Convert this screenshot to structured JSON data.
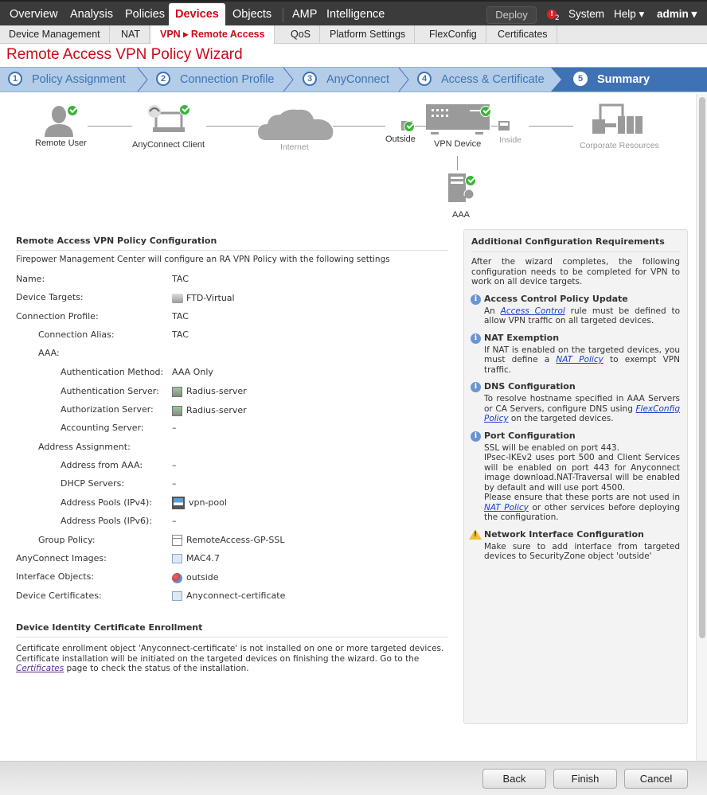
{
  "topnav": {
    "items": [
      "Overview",
      "Analysis",
      "Policies",
      "Devices",
      "Objects",
      "AMP",
      "Intelligence"
    ],
    "active": "Devices",
    "deploy": "Deploy",
    "alert_count": "2",
    "system": "System",
    "help": "Help ▾",
    "user": "admin ▾"
  },
  "subnav": {
    "items": [
      "Device Management",
      "NAT",
      "VPN ▸ Remote Access",
      "QoS",
      "Platform Settings",
      "FlexConfig",
      "Certificates"
    ],
    "active": "VPN ▸ Remote Access"
  },
  "page_title": "Remote Access VPN Policy Wizard",
  "steps": [
    {
      "num": "1",
      "label": "Policy Assignment"
    },
    {
      "num": "2",
      "label": "Connection Profile"
    },
    {
      "num": "3",
      "label": "AnyConnect"
    },
    {
      "num": "4",
      "label": "Access & Certificate"
    },
    {
      "num": "5",
      "label": "Summary",
      "active": true
    }
  ],
  "diagram": {
    "remote_user": "Remote User",
    "anyconnect_client": "AnyConnect Client",
    "internet": "Internet",
    "outside": "Outside",
    "vpn_device": "VPN Device",
    "inside": "Inside",
    "corporate_resources": "Corporate Resources",
    "aaa": "AAA"
  },
  "config": {
    "title": "Remote Access VPN Policy Configuration",
    "intro": "Firepower Management Center will configure an RA VPN Policy with the following settings",
    "rows": [
      {
        "label": "Name:",
        "value": "TAC"
      },
      {
        "label": "Device Targets:",
        "value": "FTD-Virtual",
        "icon": "device-icon"
      },
      {
        "label": "Connection Profile:",
        "value": "TAC"
      },
      {
        "label": "Connection Alias:",
        "value": "TAC"
      },
      {
        "label": "AAA:",
        "value": ""
      },
      {
        "label": "Authentication Method:",
        "value": "AAA Only"
      },
      {
        "label": "Authentication Server:",
        "value": "Radius-server",
        "icon": "radius-server-icon"
      },
      {
        "label": "Authorization Server:",
        "value": "Radius-server",
        "icon": "radius-server-icon"
      },
      {
        "label": "Accounting Server:",
        "value": "–"
      },
      {
        "label": "Address Assignment:",
        "value": ""
      },
      {
        "label": "Address from AAA:",
        "value": "–"
      },
      {
        "label": "DHCP Servers:",
        "value": "–"
      },
      {
        "label": "Address Pools (IPv4):",
        "value": "vpn-pool",
        "icon": "ipv4-pool-icon"
      },
      {
        "label": "Address Pools (IPv6):",
        "value": "–"
      },
      {
        "label": "Group Policy:",
        "value": "RemoteAccess-GP-SSL",
        "icon": "group-policy-icon"
      },
      {
        "label": "AnyConnect Images:",
        "value": "MAC4.7",
        "icon": "image-icon"
      },
      {
        "label": "Interface Objects:",
        "value": "outside",
        "icon": "interface-object-icon"
      },
      {
        "label": "Device Certificates:",
        "value": "Anyconnect-certificate",
        "icon": "certificate-icon"
      }
    ]
  },
  "cert_enrollment": {
    "title": "Device Identity Certificate Enrollment",
    "text_before": "Certificate enrollment object 'Anyconnect-certificate' is not installed on one or more targeted devices. Certificate installation will be initiated on the targeted devices on finishing the wizard. Go to the ",
    "link": "Certificates",
    "text_after": " page to check the status of the installation."
  },
  "additional": {
    "title": "Additional Configuration Requirements",
    "intro": "After the wizard completes, the following configuration needs to be completed for VPN to work on all device targets.",
    "acp": {
      "title": "Access Control Policy Update",
      "pre": "An ",
      "link": "Access Control",
      "post": " rule must be defined to allow VPN traffic on all targeted devices."
    },
    "nat": {
      "title": "NAT Exemption",
      "pre": "If NAT is enabled on the targeted devices, you must define a ",
      "link": "NAT Policy",
      "post": " to exempt VPN traffic."
    },
    "dns": {
      "title": "DNS Configuration",
      "pre": "To resolve hostname specified in AAA Servers or CA Servers, configure DNS using ",
      "link": "FlexConfig Policy",
      "post": " on the targeted devices."
    },
    "port": {
      "title": "Port Configuration",
      "line1": "SSL will be enabled on port 443.",
      "line2": "IPsec-IKEv2 uses port 500 and Client Services will be enabled on port 443 for Anyconnect image download.NAT-Traversal will be enabled by default and will use port 4500.",
      "line3_pre": "Please ensure that these ports are not used in ",
      "link": "NAT Policy",
      "line3_post": " or other services before deploying the configuration."
    },
    "nic": {
      "title": "Network Interface Configuration",
      "text": "Make sure to add interface from targeted devices to SecurityZone object 'outside'"
    }
  },
  "buttons": {
    "back": "Back",
    "finish": "Finish",
    "cancel": "Cancel"
  }
}
